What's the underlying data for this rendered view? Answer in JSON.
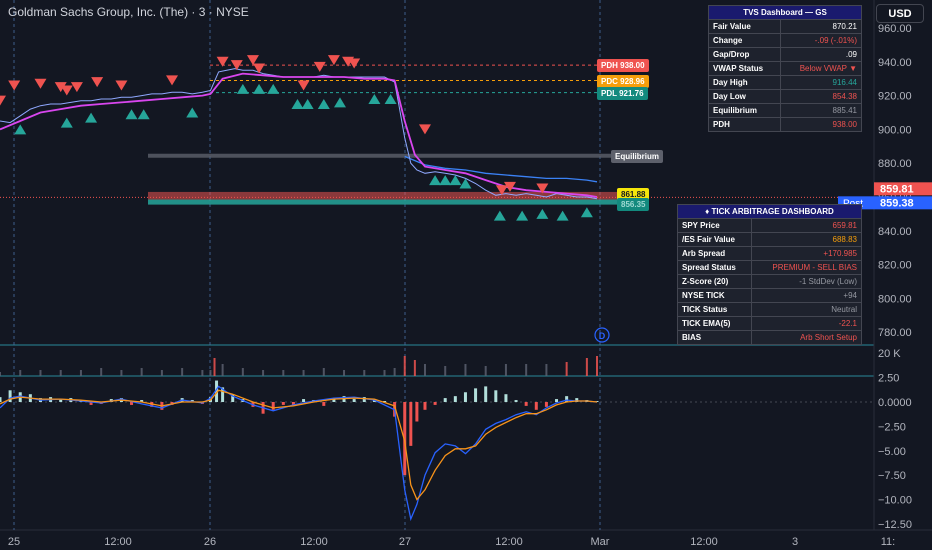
{
  "title": "Goldman Sachs Group, Inc. (The) · 3 · NYSE",
  "currency_button": "USD",
  "colors": {
    "bull": "#26a69a",
    "bear": "#ef5350",
    "vwap": "#d946ef",
    "price": "#2962ff",
    "pdc": "#f59e0b",
    "zone_red": "#ef5350",
    "zone_green": "#26a69a"
  },
  "price_axis": {
    "ticks": [
      "960.00",
      "940.00",
      "920.00",
      "900.00",
      "880.00",
      "860.00",
      "840.00",
      "820.00",
      "800.00",
      "780.00"
    ],
    "last_price": "859.81",
    "post_price": "859.38",
    "post_label": "Post"
  },
  "volume_axis": {
    "label": "20 K"
  },
  "osc_axis": {
    "ticks": [
      "2.50",
      "0.0000",
      "−2.50",
      "−5.00",
      "−7.50",
      "−10.00",
      "−12.50"
    ]
  },
  "time_axis": {
    "ticks": [
      "25",
      "12:00",
      "26",
      "12:00",
      "27",
      "12:00",
      "Mar",
      "12:00",
      "3",
      "11:"
    ]
  },
  "levels": {
    "pdh": "PDH 938.00",
    "pdc": "PDC 928.96",
    "pdl": "PDL 921.76",
    "equilibrium": "Equilibrium",
    "zone_top": "861.88",
    "zone_bottom": "856.35"
  },
  "event_marker": "D",
  "tvs": {
    "header": "TVS Dashboard — GS",
    "rows": [
      {
        "label": "Fair Value",
        "value": "870.21",
        "color": "#ffffff"
      },
      {
        "label": "Change",
        "value": "-.09 (-.01%)",
        "color": "#ef5350"
      },
      {
        "label": "Gap/Drop",
        "value": ".09",
        "color": "#ffffff"
      },
      {
        "label": "VWAP Status",
        "value": "Below VWAP ▼",
        "color": "#ef5350"
      },
      {
        "label": "Day High",
        "value": "916.44",
        "color": "#26a69a"
      },
      {
        "label": "Day Low",
        "value": "854.38",
        "color": "#ef5350"
      },
      {
        "label": "Equilibrium",
        "value": "885.41",
        "color": "#9598a1"
      },
      {
        "label": "PDH",
        "value": "938.00",
        "color": "#ef5350"
      }
    ]
  },
  "tick": {
    "header": "♦ TICK ARBITRAGE DASHBOARD",
    "rows": [
      {
        "label": "SPY Price",
        "value": "659.81",
        "color": "#ef5350"
      },
      {
        "label": "/ES Fair Value",
        "value": "688.83",
        "color": "#f59e0b"
      },
      {
        "label": "Arb Spread",
        "value": "+170.985",
        "color": "#ef5350"
      },
      {
        "label": "Spread Status",
        "value": "PREMIUM - SELL BIAS",
        "color": "#ef5350"
      },
      {
        "label": "Z-Score (20)",
        "value": "-1 StdDev (Low)",
        "color": "#9598a1"
      },
      {
        "label": "NYSE TICK",
        "value": "+94",
        "color": "#9598a1"
      },
      {
        "label": "TICK Status",
        "value": "Neutral",
        "color": "#9598a1"
      },
      {
        "label": "TICK EMA(5)",
        "value": "-22.1",
        "color": "#ef5350"
      },
      {
        "label": "BIAS",
        "value": "Arb Short Setup",
        "color": "#ef5350"
      }
    ]
  },
  "chart_data": {
    "type": "line",
    "ylim": [
      775,
      965
    ],
    "price": [
      [
        0,
        905
      ],
      [
        5,
        904
      ],
      [
        10,
        908
      ],
      [
        15,
        912
      ],
      [
        20,
        914
      ],
      [
        25,
        915
      ],
      [
        30,
        915
      ],
      [
        35,
        916
      ],
      [
        40,
        917
      ],
      [
        45,
        917
      ],
      [
        50,
        918
      ],
      [
        55,
        918
      ],
      [
        60,
        919
      ],
      [
        65,
        919
      ],
      [
        70,
        920
      ],
      [
        75,
        921
      ],
      [
        80,
        921
      ],
      [
        85,
        922
      ],
      [
        90,
        922
      ],
      [
        95,
        921
      ],
      [
        100,
        922
      ],
      [
        104,
        923
      ],
      [
        108,
        934
      ],
      [
        112,
        935
      ],
      [
        116,
        936
      ],
      [
        120,
        935
      ],
      [
        125,
        935
      ],
      [
        130,
        933
      ],
      [
        135,
        932
      ],
      [
        140,
        931
      ],
      [
        145,
        931
      ],
      [
        150,
        931
      ],
      [
        155,
        931
      ],
      [
        160,
        932
      ],
      [
        165,
        931
      ],
      [
        170,
        931
      ],
      [
        175,
        931
      ],
      [
        180,
        931
      ],
      [
        185,
        931
      ],
      [
        190,
        931
      ],
      [
        195,
        928
      ],
      [
        197,
        915
      ],
      [
        200,
        895
      ],
      [
        203,
        880
      ],
      [
        206,
        876
      ],
      [
        210,
        874
      ],
      [
        215,
        875
      ],
      [
        220,
        874
      ],
      [
        225,
        873
      ],
      [
        230,
        871
      ],
      [
        235,
        868
      ],
      [
        240,
        864
      ],
      [
        245,
        861
      ],
      [
        250,
        862
      ],
      [
        255,
        861
      ],
      [
        260,
        862
      ],
      [
        265,
        861
      ],
      [
        270,
        860
      ],
      [
        275,
        862
      ],
      [
        280,
        861
      ],
      [
        285,
        860
      ],
      [
        290,
        860
      ],
      [
        295,
        859
      ]
    ],
    "vwap": [
      [
        0,
        900
      ],
      [
        10,
        905
      ],
      [
        20,
        910
      ],
      [
        30,
        912
      ],
      [
        40,
        914
      ],
      [
        50,
        915
      ],
      [
        60,
        916
      ],
      [
        70,
        917
      ],
      [
        80,
        918
      ],
      [
        90,
        919
      ],
      [
        100,
        920
      ],
      [
        104,
        921
      ],
      [
        110,
        930
      ],
      [
        120,
        933
      ],
      [
        130,
        932
      ],
      [
        140,
        931
      ],
      [
        150,
        931
      ],
      [
        160,
        931
      ],
      [
        170,
        931
      ],
      [
        180,
        930
      ],
      [
        190,
        930
      ],
      [
        195,
        929
      ],
      [
        200,
        905
      ],
      [
        205,
        885
      ],
      [
        210,
        878
      ],
      [
        220,
        876
      ],
      [
        230,
        874
      ],
      [
        240,
        870
      ],
      [
        250,
        866
      ],
      [
        260,
        864
      ],
      [
        270,
        863
      ],
      [
        280,
        862
      ],
      [
        290,
        861
      ],
      [
        295,
        860
      ]
    ],
    "trend": [
      [
        200,
        884
      ],
      [
        210,
        879
      ],
      [
        220,
        877
      ],
      [
        230,
        876
      ],
      [
        240,
        874
      ],
      [
        250,
        873
      ],
      [
        260,
        872
      ],
      [
        270,
        871
      ],
      [
        280,
        871
      ],
      [
        290,
        870
      ],
      [
        295,
        869
      ]
    ],
    "bear_signals": [
      [
        0,
        917
      ],
      [
        7,
        926
      ],
      [
        20,
        927
      ],
      [
        30,
        925
      ],
      [
        33,
        923
      ],
      [
        38,
        925
      ],
      [
        48,
        928
      ],
      [
        60,
        926
      ],
      [
        85,
        929
      ],
      [
        110,
        940
      ],
      [
        117,
        938
      ],
      [
        125,
        941
      ],
      [
        128,
        936
      ],
      [
        150,
        926
      ],
      [
        158,
        937
      ],
      [
        165,
        941
      ],
      [
        172,
        940
      ],
      [
        175,
        939
      ],
      [
        210,
        900
      ],
      [
        248,
        864
      ],
      [
        252,
        866
      ],
      [
        268,
        865
      ]
    ],
    "bull_signals": [
      [
        10,
        900
      ],
      [
        33,
        904
      ],
      [
        45,
        907
      ],
      [
        65,
        909
      ],
      [
        71,
        909
      ],
      [
        95,
        910
      ],
      [
        120,
        924
      ],
      [
        128,
        924
      ],
      [
        135,
        924
      ],
      [
        147,
        915
      ],
      [
        152,
        915
      ],
      [
        160,
        915
      ],
      [
        168,
        916
      ],
      [
        185,
        918
      ],
      [
        193,
        918
      ],
      [
        215,
        870
      ],
      [
        220,
        870
      ],
      [
        225,
        870
      ],
      [
        230,
        868
      ],
      [
        247,
        849
      ],
      [
        258,
        849
      ],
      [
        268,
        850
      ],
      [
        278,
        849
      ],
      [
        290,
        851
      ]
    ],
    "volume": [
      [
        0,
        2
      ],
      [
        10,
        3
      ],
      [
        20,
        3
      ],
      [
        30,
        3
      ],
      [
        40,
        3
      ],
      [
        50,
        4
      ],
      [
        60,
        3
      ],
      [
        70,
        4
      ],
      [
        80,
        3
      ],
      [
        90,
        4
      ],
      [
        100,
        3
      ],
      [
        104,
        3
      ],
      [
        106,
        9
      ],
      [
        110,
        6
      ],
      [
        120,
        4
      ],
      [
        130,
        3
      ],
      [
        140,
        3
      ],
      [
        150,
        3
      ],
      [
        160,
        4
      ],
      [
        170,
        3
      ],
      [
        180,
        3
      ],
      [
        190,
        3
      ],
      [
        195,
        4
      ],
      [
        200,
        10
      ],
      [
        205,
        8
      ],
      [
        210,
        6
      ],
      [
        220,
        5
      ],
      [
        230,
        6
      ],
      [
        240,
        5
      ],
      [
        250,
        6
      ],
      [
        260,
        6
      ],
      [
        270,
        6
      ],
      [
        280,
        7
      ],
      [
        290,
        9
      ],
      [
        295,
        10
      ]
    ],
    "osc_hist": [
      [
        0,
        0.5
      ],
      [
        5,
        1.2
      ],
      [
        10,
        1.0
      ],
      [
        15,
        0.8
      ],
      [
        20,
        0.4
      ],
      [
        25,
        0.5
      ],
      [
        30,
        0.3
      ],
      [
        35,
        0.4
      ],
      [
        40,
        0.2
      ],
      [
        45,
        -0.3
      ],
      [
        50,
        -0.2
      ],
      [
        55,
        0.3
      ],
      [
        60,
        0.4
      ],
      [
        65,
        -0.3
      ],
      [
        70,
        0.2
      ],
      [
        75,
        -0.5
      ],
      [
        80,
        -0.8
      ],
      [
        85,
        -0.3
      ],
      [
        90,
        0.4
      ],
      [
        95,
        0.2
      ],
      [
        100,
        -0.2
      ],
      [
        104,
        0.5
      ],
      [
        107,
        2.2
      ],
      [
        110,
        1.5
      ],
      [
        115,
        0.8
      ],
      [
        120,
        0.3
      ],
      [
        125,
        -0.5
      ],
      [
        130,
        -1.2
      ],
      [
        135,
        -0.8
      ],
      [
        140,
        -0.3
      ],
      [
        145,
        -0.4
      ],
      [
        150,
        0.3
      ],
      [
        155,
        0.2
      ],
      [
        160,
        -0.4
      ],
      [
        165,
        0.3
      ],
      [
        170,
        0.6
      ],
      [
        175,
        0.3
      ],
      [
        180,
        0.5
      ],
      [
        185,
        0.2
      ],
      [
        190,
        0.1
      ],
      [
        195,
        -1.5
      ],
      [
        200,
        -7.5
      ],
      [
        203,
        -4.5
      ],
      [
        206,
        -2.0
      ],
      [
        210,
        -0.8
      ],
      [
        215,
        -0.3
      ],
      [
        220,
        0.4
      ],
      [
        225,
        0.6
      ],
      [
        230,
        1.0
      ],
      [
        235,
        1.4
      ],
      [
        240,
        1.6
      ],
      [
        245,
        1.2
      ],
      [
        250,
        0.8
      ],
      [
        255,
        0.2
      ],
      [
        260,
        -0.4
      ],
      [
        265,
        -0.8
      ],
      [
        270,
        -0.5
      ],
      [
        275,
        0.3
      ],
      [
        280,
        0.6
      ],
      [
        285,
        0.4
      ],
      [
        290,
        0.2
      ],
      [
        295,
        0.1
      ]
    ],
    "osc_fast": [
      [
        0,
        -0.6
      ],
      [
        5,
        0.4
      ],
      [
        10,
        0.6
      ],
      [
        20,
        0.2
      ],
      [
        30,
        0.3
      ],
      [
        40,
        0.1
      ],
      [
        50,
        -0.1
      ],
      [
        60,
        0.3
      ],
      [
        70,
        -0.2
      ],
      [
        80,
        -0.6
      ],
      [
        90,
        0.2
      ],
      [
        100,
        -0.1
      ],
      [
        104,
        0.4
      ],
      [
        108,
        1.6
      ],
      [
        115,
        0.6
      ],
      [
        125,
        -0.3
      ],
      [
        135,
        -0.9
      ],
      [
        145,
        -0.3
      ],
      [
        155,
        0.1
      ],
      [
        165,
        0.4
      ],
      [
        175,
        0.5
      ],
      [
        185,
        0.2
      ],
      [
        195,
        -0.8
      ],
      [
        200,
        -9.0
      ],
      [
        203,
        -12.0
      ],
      [
        206,
        -10.5
      ],
      [
        210,
        -7.5
      ],
      [
        215,
        -5.2
      ],
      [
        220,
        -4.3
      ],
      [
        225,
        -4.5
      ],
      [
        230,
        -5.3
      ],
      [
        235,
        -4.3
      ],
      [
        240,
        -2.8
      ],
      [
        245,
        -2.2
      ],
      [
        250,
        -1.8
      ],
      [
        255,
        -1.3
      ],
      [
        260,
        -1.0
      ],
      [
        265,
        -1.3
      ],
      [
        270,
        -0.6
      ],
      [
        275,
        -0.1
      ],
      [
        280,
        0.2
      ],
      [
        285,
        0.1
      ],
      [
        290,
        0.1
      ],
      [
        295,
        0.0
      ]
    ],
    "osc_slow": [
      [
        0,
        -0.2
      ],
      [
        5,
        0.3
      ],
      [
        10,
        0.5
      ],
      [
        20,
        0.3
      ],
      [
        30,
        0.3
      ],
      [
        40,
        0.2
      ],
      [
        50,
        0.0
      ],
      [
        60,
        0.2
      ],
      [
        70,
        0.0
      ],
      [
        80,
        -0.4
      ],
      [
        90,
        0.0
      ],
      [
        100,
        0.0
      ],
      [
        104,
        0.2
      ],
      [
        108,
        1.2
      ],
      [
        115,
        0.8
      ],
      [
        125,
        0.0
      ],
      [
        135,
        -0.6
      ],
      [
        145,
        -0.4
      ],
      [
        155,
        0.0
      ],
      [
        165,
        0.3
      ],
      [
        175,
        0.4
      ],
      [
        185,
        0.3
      ],
      [
        195,
        -0.4
      ],
      [
        200,
        -4.0
      ],
      [
        203,
        -8.5
      ],
      [
        206,
        -10.0
      ],
      [
        210,
        -9.0
      ],
      [
        215,
        -7.0
      ],
      [
        220,
        -5.5
      ],
      [
        225,
        -4.8
      ],
      [
        230,
        -4.8
      ],
      [
        235,
        -4.5
      ],
      [
        240,
        -3.3
      ],
      [
        245,
        -2.6
      ],
      [
        250,
        -2.1
      ],
      [
        255,
        -1.6
      ],
      [
        260,
        -1.2
      ],
      [
        265,
        -1.2
      ],
      [
        270,
        -0.8
      ],
      [
        275,
        -0.3
      ],
      [
        280,
        0.0
      ],
      [
        285,
        0.1
      ],
      [
        290,
        0.1
      ],
      [
        295,
        0.0
      ]
    ]
  }
}
